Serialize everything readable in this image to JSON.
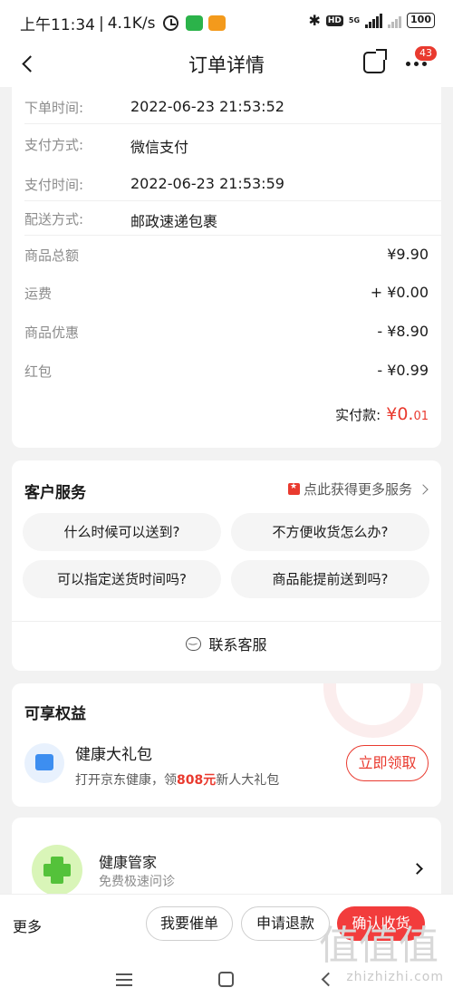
{
  "status_bar": {
    "time": "上午11:34",
    "speed": "4.1K/s",
    "network_hd": "HD",
    "network_gen": "5G",
    "battery": "100"
  },
  "header": {
    "title": "订单详情",
    "message_badge": "43"
  },
  "order_info": {
    "rows": [
      {
        "label": "下单时间:",
        "value": "2022-06-23  21:53:52"
      },
      {
        "label": "支付方式:",
        "value": "微信支付"
      },
      {
        "label": "支付时间:",
        "value": "2022-06-23  21:53:59"
      },
      {
        "label": "配送方式:",
        "value": "邮政速递包裹"
      }
    ],
    "amounts": [
      {
        "label": "商品总额",
        "value": "¥9.90"
      },
      {
        "label": "运费",
        "value": "+ ¥0.00"
      },
      {
        "label": "商品优惠",
        "value": "- ¥8.90"
      },
      {
        "label": "红包",
        "value": "- ¥0.99"
      }
    ],
    "paid_label": "实付款:",
    "paid_int": "¥0.",
    "paid_dec": "01"
  },
  "service": {
    "title": "客户服务",
    "link": "点此获得更多服务",
    "faqs": [
      "什么时候可以送到?",
      "不方便收货怎么办?",
      "可以指定送货时间吗?",
      "商品能提前送到吗?"
    ],
    "contact": "联系客服"
  },
  "benefit": {
    "title": "可享权益",
    "name": "健康大礼包",
    "desc_prefix": "打开京东健康，领",
    "desc_highlight": "808元",
    "desc_suffix": "新人大礼包",
    "button": "立即领取"
  },
  "health": {
    "name": "健康管家",
    "desc": "免费极速问诊"
  },
  "actions": {
    "more": "更多",
    "urge": "我要催单",
    "refund": "申请退款",
    "confirm": "确认收货"
  },
  "watermark": {
    "text": "zhizhizhi.com",
    "glyphs": "值值值"
  },
  "colors": {
    "accent": "#e93a2f",
    "confirm_button": "#f23c3c",
    "health_green": "#54c23a"
  },
  "icons": {
    "status": [
      "alarm-icon",
      "wechat-icon",
      "app-icon",
      "bluetooth-icon",
      "signal-icon",
      "battery-icon"
    ],
    "header": [
      "back-icon",
      "share-icon",
      "more-icon"
    ],
    "service": [
      "star-icon",
      "chevron-right-icon",
      "chat-icon"
    ],
    "nav": [
      "menu-icon",
      "home-icon",
      "back-nav-icon"
    ]
  }
}
